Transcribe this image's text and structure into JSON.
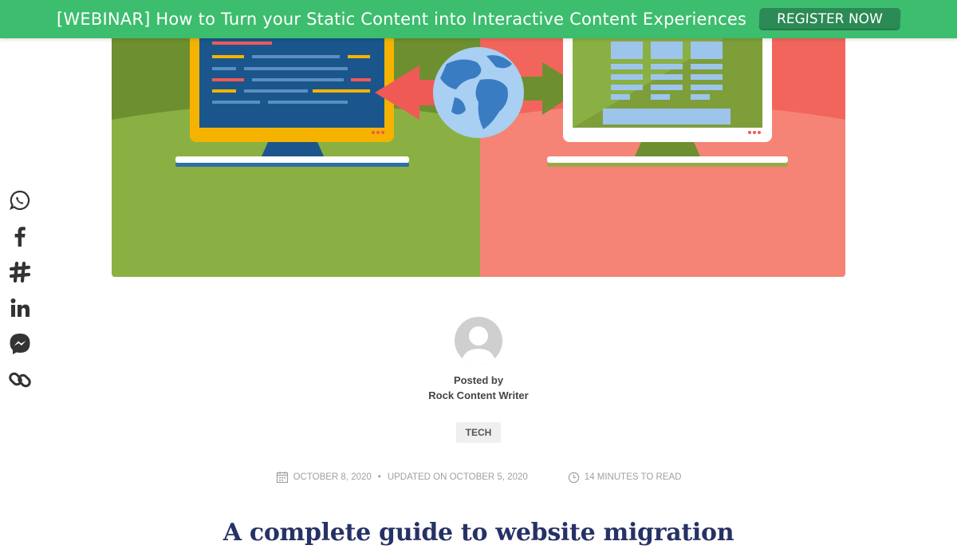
{
  "banner": {
    "text": "[WEBINAR] How to Turn your Static Content into Interactive Content Experiences",
    "button_label": "REGISTER NOW",
    "color": "#3dbd6e",
    "button_color": "#2b8a55"
  },
  "share": {
    "icons": [
      "whatsapp-icon",
      "facebook-icon",
      "slack-icon",
      "linkedin-icon",
      "messenger-icon",
      "link-icon"
    ]
  },
  "author": {
    "posted_by_label": "Posted by",
    "name": "Rock Content Writer"
  },
  "tag": {
    "label": "TECH"
  },
  "meta": {
    "date": "OCTOBER 8, 2020",
    "separator": "•",
    "updated": "UPDATED ON OCTOBER 5, 2020",
    "read_time": "14 MINUTES TO READ"
  },
  "article": {
    "title": "A complete guide to website migration"
  },
  "colors": {
    "title": "#263266",
    "hero_green": "#8ab043",
    "hero_red": "#f47e70"
  }
}
